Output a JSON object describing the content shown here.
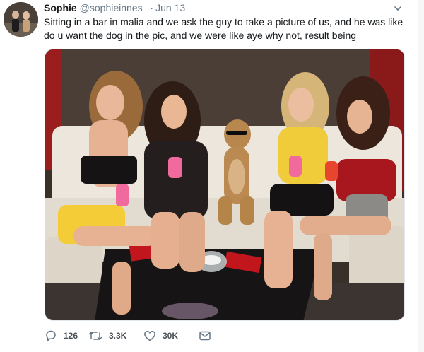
{
  "tweet": {
    "display_name": "Sophie",
    "handle": "@sophieinnes_",
    "separator": "·",
    "time": "Jun 13",
    "text": "Sitting in a bar in malia and we ask the guy to take a picture of us, and he was like do u want the dog in the pic, and we were like aye why not, result being"
  },
  "actions": {
    "reply_count": "126",
    "retweet_count": "3.3K",
    "like_count": "30K"
  },
  "icons": {
    "reply": "reply-icon",
    "retweet": "retweet-icon",
    "like": "heart-icon",
    "message": "direct-message-icon",
    "caret": "chevron-down-icon"
  },
  "colors": {
    "text_primary": "#14171a",
    "text_secondary": "#657786",
    "icon": "#657786"
  }
}
